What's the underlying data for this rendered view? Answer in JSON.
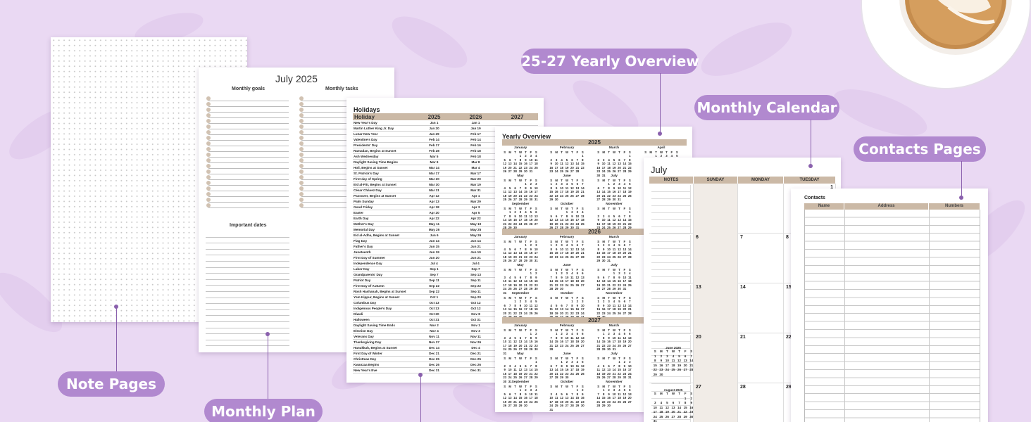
{
  "labels": {
    "note_pages": "Note Pages",
    "monthly_plan": "Monthly Plan",
    "yearly_overview": "25-27 Yearly Overview",
    "monthly_calendar": "Monthly Calendar",
    "contacts_pages": "Contacts Pages"
  },
  "colors": {
    "background": "#ead9f3",
    "accent": "#b189cf",
    "table_header": "#cbb9a6"
  },
  "monthly_plan": {
    "title": "July 2025",
    "goals_heading": "Monthly goals",
    "tasks_heading": "Monthly tasks",
    "dates_heading": "Important dates"
  },
  "holidays": {
    "title": "Holidays",
    "headers": [
      "Holiday",
      "2025",
      "2026",
      "2027"
    ],
    "rows": [
      [
        "New Year's Day",
        "Jan 1",
        "Jan 1"
      ],
      [
        "Martin Luther King Jr. Day",
        "Jan 20",
        "Jan 19"
      ],
      [
        "Lunar New Year",
        "Jan 29",
        "Feb 17"
      ],
      [
        "Valentine's Day",
        "Feb 14",
        "Feb 14"
      ],
      [
        "Presidents' Day",
        "Feb 17",
        "Feb 16"
      ],
      [
        "Ramadan, Begins at Sunset",
        "Feb 28",
        "Feb 18"
      ],
      [
        "Ash Wednesday",
        "Mar 5",
        "Feb 18"
      ],
      [
        "Daylight Saving Time Begins",
        "Mar 9",
        "Mar 8"
      ],
      [
        "Holi, Begins at Sunset",
        "Mar 14",
        "Mar 4"
      ],
      [
        "St. Patrick's Day",
        "Mar 17",
        "Mar 17"
      ],
      [
        "First day of Spring",
        "Mar 20",
        "Mar 20"
      ],
      [
        "Eid al-Fitr, Begins at Sunset",
        "Mar 30",
        "Mar 19"
      ],
      [
        "César Chávez Day",
        "Mar 31",
        "Mar 31"
      ],
      [
        "Passover, Begins at Sunset",
        "Apr 12",
        "Apr 1"
      ],
      [
        "Palm Sunday",
        "Apr 13",
        "Mar 29"
      ],
      [
        "Good Friday",
        "Apr 18",
        "Apr 3"
      ],
      [
        "Easter",
        "Apr 20",
        "Apr 5"
      ],
      [
        "Earth Day",
        "Apr 22",
        "Apr 22"
      ],
      [
        "Mother's Day",
        "May 11",
        "May 10"
      ],
      [
        "Memorial Day",
        "May 26",
        "May 25"
      ],
      [
        "Eid al-Adha, Begins at Sunset",
        "Jun 6",
        "May 26"
      ],
      [
        "Flag Day",
        "Jun 14",
        "Jun 14"
      ],
      [
        "Father's Day",
        "Jun 15",
        "Jun 21"
      ],
      [
        "Juneteenth",
        "Jun 19",
        "Jun 19"
      ],
      [
        "First Day of Summer",
        "Jun 20",
        "Jun 21"
      ],
      [
        "Independence Day",
        "Jul 4",
        "Jul 4"
      ],
      [
        "Labor Day",
        "Sep 1",
        "Sep 7"
      ],
      [
        "Grandparents' Day",
        "Sep 7",
        "Sep 13"
      ],
      [
        "Patriot Day",
        "Sep 11",
        "Sep 11"
      ],
      [
        "First Day of Autumn",
        "Sep 22",
        "Sep 22"
      ],
      [
        "Rosh Hashanah, Begins at Sunset",
        "Sep 22",
        "Sep 11"
      ],
      [
        "Yom Kippur, Begins at Sunset",
        "Oct 1",
        "Sep 20"
      ],
      [
        "Columbus Day",
        "Oct 13",
        "Oct 12"
      ],
      [
        "Indigenous People's Day",
        "Oct 13",
        "Oct 12"
      ],
      [
        "Diwali",
        "Oct 20",
        "Nov 8"
      ],
      [
        "Halloween",
        "Oct 31",
        "Oct 31"
      ],
      [
        "Daylight Saving Time Ends",
        "Nov 2",
        "Nov 1"
      ],
      [
        "Election Day",
        "Nov 4",
        "Nov 3"
      ],
      [
        "Veterans Day",
        "Nov 11",
        "Nov 11"
      ],
      [
        "Thanksgiving Day",
        "Nov 27",
        "Nov 26"
      ],
      [
        "Hanukkah, Begins at Sunset",
        "Dec 14",
        "Dec 4"
      ],
      [
        "First Day of Winter",
        "Dec 21",
        "Dec 21"
      ],
      [
        "Christmas Day",
        "Dec 25",
        "Dec 25"
      ],
      [
        "Kwanzaa Begins",
        "Dec 26",
        "Dec 26"
      ],
      [
        "New Year's Eve",
        "Dec 31",
        "Dec 31"
      ]
    ]
  },
  "yearly": {
    "title": "Yearly Overview",
    "years": [
      "2025",
      "2026",
      "2027"
    ],
    "weekday_letters": [
      "S",
      "M",
      "T",
      "W",
      "T",
      "F",
      "S"
    ],
    "months": [
      "January",
      "February",
      "March",
      "April",
      "May",
      "June",
      "July",
      "August",
      "September",
      "October",
      "November",
      "December"
    ]
  },
  "calendar": {
    "title": "July",
    "headers": [
      "NOTES",
      "SUNDAY",
      "MONDAY",
      "TUESDAY"
    ],
    "weeks": [
      [
        "",
        "",
        ""
      ],
      [
        "6",
        "7",
        "8"
      ],
      [
        "13",
        "14",
        "15"
      ],
      [
        "20",
        "21",
        "22"
      ],
      [
        "27",
        "28",
        "29"
      ]
    ],
    "first_tuesday": "1",
    "mini_prev": "June 2025",
    "mini_next": "August 2025"
  },
  "contacts": {
    "title": "Contacts",
    "headers": [
      "Name",
      "Address",
      "Numbers"
    ]
  }
}
